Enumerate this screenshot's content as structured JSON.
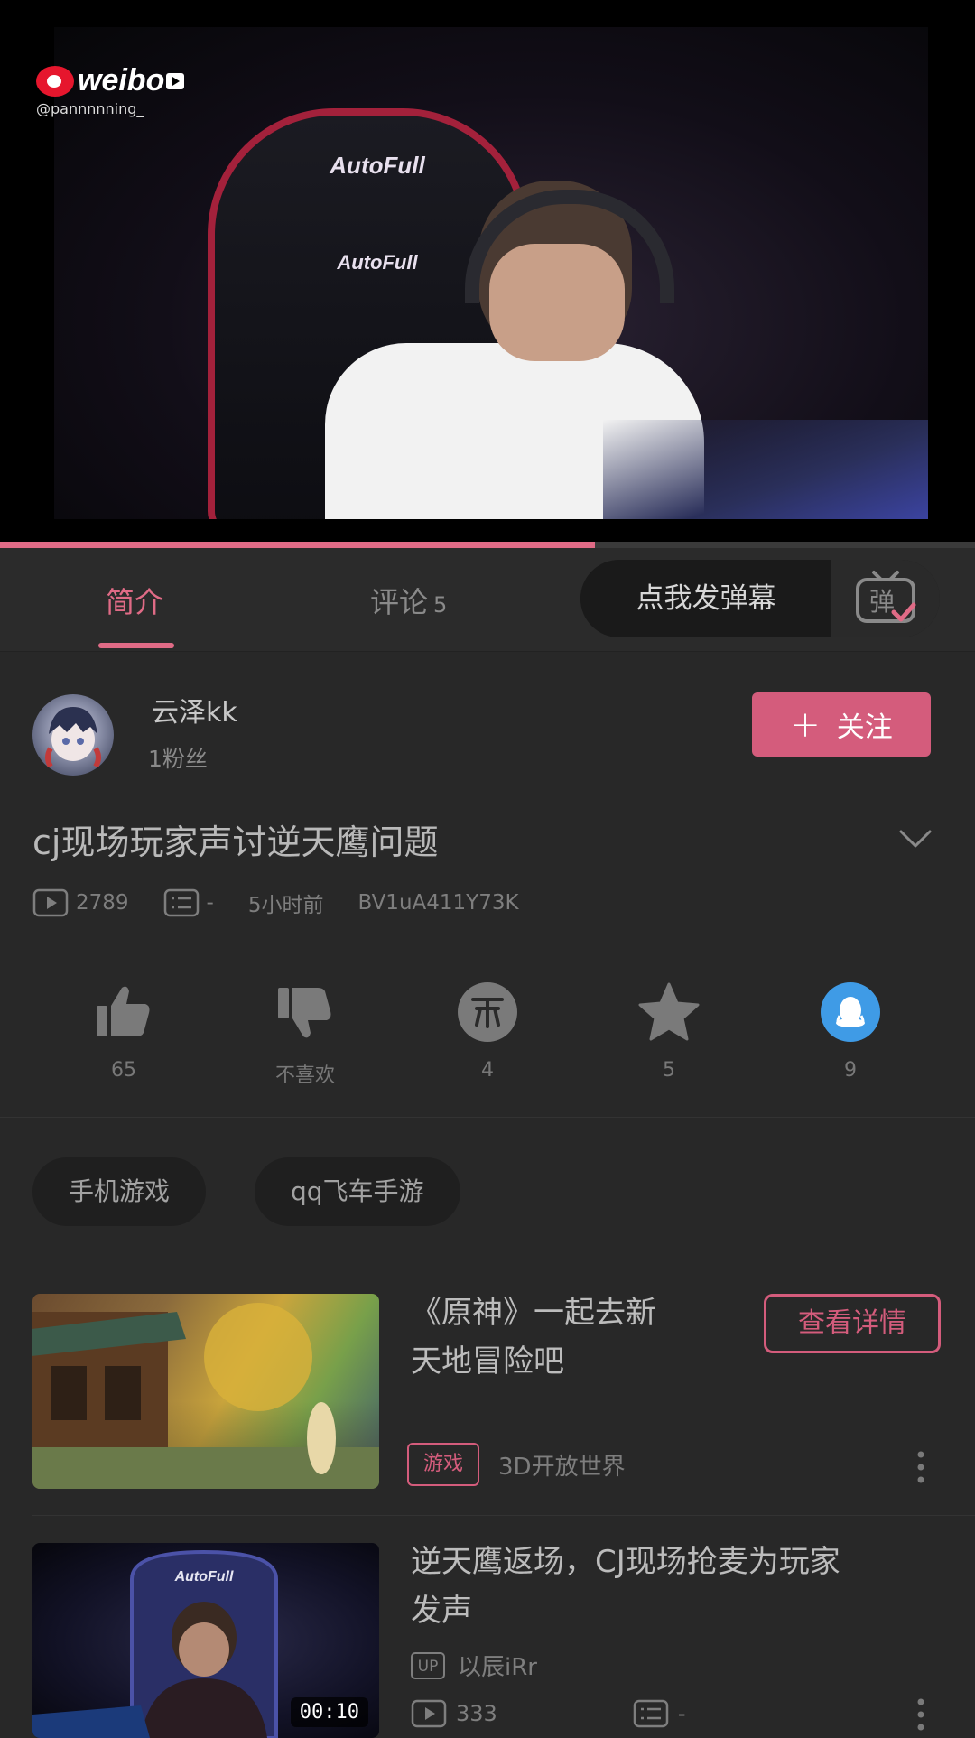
{
  "video": {
    "watermark_brand": "weibo",
    "watermark_handle": "@pannnnning_",
    "chair_brand_top": "AutoFull",
    "chair_brand_bottom": "AutoFull",
    "progress": 0.61
  },
  "tabs": {
    "intro_label": "简介",
    "comments_label": "评论",
    "comments_count": "5",
    "danmaku_placeholder": "点我发弹幕",
    "danmaku_button_glyph": "弹"
  },
  "uploader": {
    "name": "云泽kk",
    "fans": "1粉丝",
    "follow_label": "关注"
  },
  "video_info": {
    "title": "cj现场玩家声讨逆天鹰问题",
    "plays": "2789",
    "danmaku": "-",
    "time_ago": "5小时前",
    "bvid": "BV1uA411Y73K"
  },
  "actions": {
    "like_count": "65",
    "dislike_label": "不喜欢",
    "coin_count": "4",
    "favorite_count": "5",
    "share_count": "9"
  },
  "tags": [
    "手机游戏",
    "qq飞车手游"
  ],
  "recommendations": [
    {
      "title_line1": "《原神》一起去新",
      "title_line2": "天地冒险吧",
      "detail_button": "查看详情",
      "category_badge": "游戏",
      "category_text": "3D开放世界"
    },
    {
      "title_line1": "逆天鹰返场，CJ现场抢麦为玩家",
      "title_line2": "发声",
      "duration": "00:10",
      "up_badge": "UP",
      "uploader": "以辰iRr",
      "plays": "333",
      "danmaku": "-",
      "thumb_chair_brand": "AutoFull"
    }
  ],
  "colors": {
    "accent": "#d45c7c",
    "background": "#282828",
    "share_blue": "#3f9be6"
  }
}
